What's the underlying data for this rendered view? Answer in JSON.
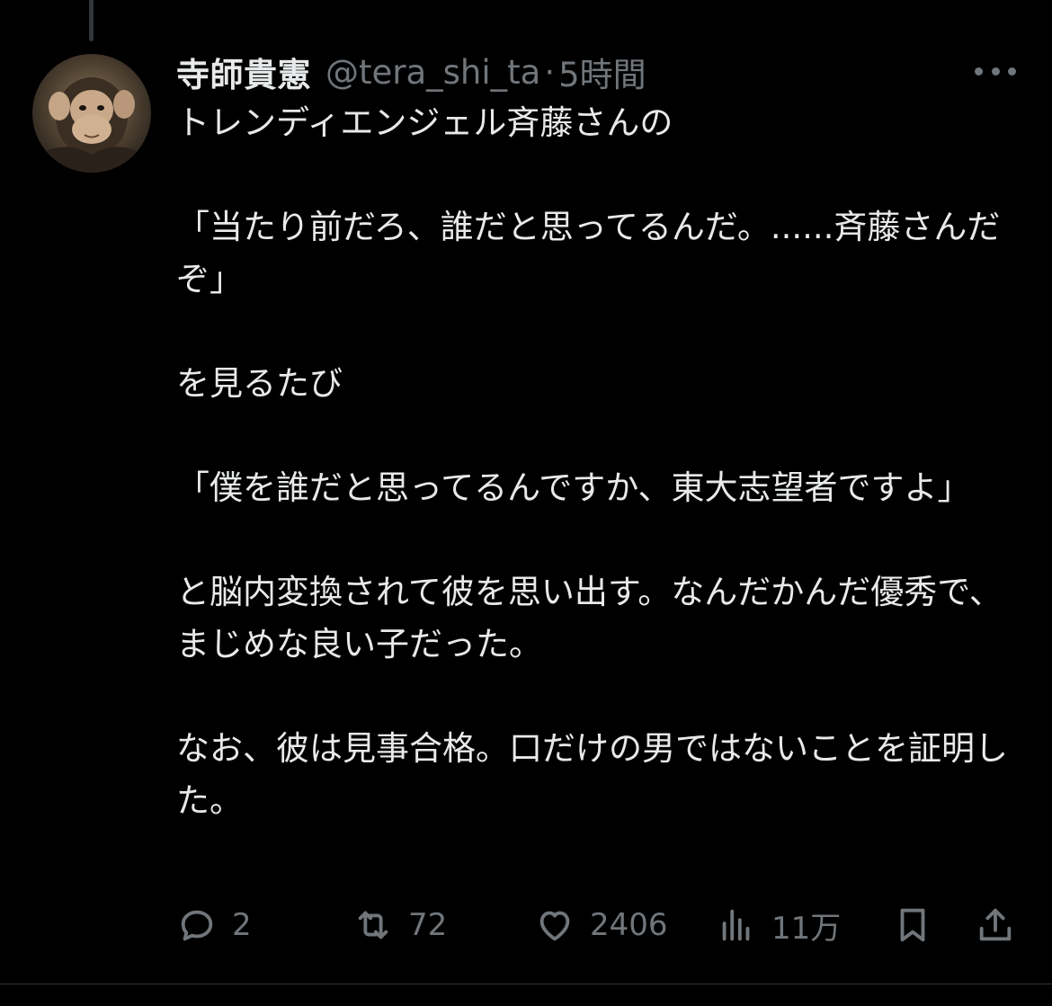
{
  "tweet": {
    "display_name": "寺師貴憲",
    "handle": "@tera_shi_ta",
    "separator": "·",
    "time": "5時間",
    "text": "トレンディエンジェル斉藤さんの\n\n「当たり前だろ、誰だと思ってるんだ。......斉藤さんだぞ」\n\nを見るたび\n\n「僕を誰だと思ってるんですか、東大志望者ですよ」\n\nと脳内変換されて彼を思い出す。なんだかんだ優秀で、まじめな良い子だった。\n\nなお、彼は見事合格。口だけの男ではないことを証明した。"
  },
  "actions": {
    "reply": {
      "icon": "reply-icon",
      "count": "2"
    },
    "retweet": {
      "icon": "retweet-icon",
      "count": "72"
    },
    "like": {
      "icon": "heart-icon",
      "count": "2406"
    },
    "views": {
      "icon": "views-icon",
      "count": "11万"
    },
    "bookmark": {
      "icon": "bookmark-icon"
    },
    "share": {
      "icon": "share-icon"
    }
  },
  "colors": {
    "background": "#000000",
    "primary_text": "#e7e9ea",
    "secondary_text": "#71767b",
    "divider": "#2f3336"
  }
}
